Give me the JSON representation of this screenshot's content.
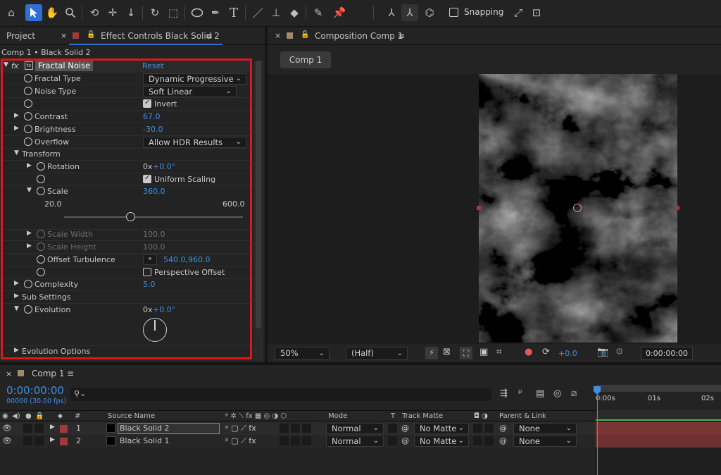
{
  "toolbar": {
    "snapping_label": "Snapping",
    "icons": [
      "home-icon",
      "selection-tool-icon",
      "hand-tool-icon",
      "zoom-tool-icon",
      "orbit-camera-icon",
      "pan-camera-icon",
      "dolly-camera-icon",
      "rotate-tool-icon",
      "pan-behind-icon",
      "ellipse-tool-icon",
      "pen-tool-icon",
      "type-tool-icon",
      "brush-tool-icon",
      "clone-stamp-icon",
      "eraser-icon",
      "roto-brush-icon",
      "puppet-pin-icon"
    ]
  },
  "effect_panel": {
    "tab_project": "Project",
    "tab_effect": "Effect Controls Black Solid 2",
    "breadcrumb": "Comp 1 • Black Solid 2",
    "effect_name": "Fractal Noise",
    "reset": "Reset",
    "fractal_type_label": "Fractal Type",
    "fractal_type_value": "Dynamic Progressive",
    "noise_type_label": "Noise Type",
    "noise_type_value": "Soft Linear",
    "invert_label": "Invert",
    "contrast_label": "Contrast",
    "contrast_value": "67.0",
    "brightness_label": "Brightness",
    "brightness_value": "-30.0",
    "overflow_label": "Overflow",
    "overflow_value": "Allow HDR Results",
    "transform_label": "Transform",
    "rotation_label": "Rotation",
    "rotation_value_a": "0x",
    "rotation_value_b": "+0.0°",
    "uniform_scaling_label": "Uniform Scaling",
    "scale_label": "Scale",
    "scale_value": "360.0",
    "scale_min": "20.0",
    "scale_max": "600.0",
    "scale_fraction": 0.371,
    "scale_width_label": "Scale Width",
    "scale_width_value": "100.0",
    "scale_height_label": "Scale Height",
    "scale_height_value": "100.0",
    "offset_label": "Offset Turbulence",
    "offset_value": "540.0,960.0",
    "perspective_label": "Perspective Offset",
    "complexity_label": "Complexity",
    "complexity_value": "5.0",
    "sub_settings_label": "Sub Settings",
    "evolution_label": "Evolution",
    "evolution_value_a": "0x",
    "evolution_value_b": "+0.0°",
    "evolution_options_label": "Evolution Options"
  },
  "composition": {
    "tab_title": "Composition Comp 1",
    "comp_button": "Comp 1",
    "zoom": "50%",
    "resolution": "(Half)",
    "exposure": "+0.0",
    "timecode": "0:00:00:00"
  },
  "timeline": {
    "tab_title": "Comp 1",
    "current_time": "0:00:00:00",
    "frame_info": "00000 (30.00 fps)",
    "ruler_labels": [
      "0:00s",
      "01s",
      "02s"
    ],
    "headers": {
      "number": "#",
      "source_name": "Source Name",
      "mode": "Mode",
      "t": "T",
      "track_matte": "Track Matte",
      "parent_link": "Parent & Link"
    },
    "layers": [
      {
        "num": "1",
        "name": "Black Solid 2",
        "mode": "Normal",
        "matte": "No Matte",
        "parent": "None"
      },
      {
        "num": "2",
        "name": "Black Solid 1",
        "mode": "Normal",
        "matte": "No Matte",
        "parent": "None"
      }
    ]
  },
  "colors": {
    "accent_blue": "#3d8fe6",
    "highlight_red": "#e0161e",
    "layer_label_red": "#a33a3a",
    "track_bar": "#7a3434"
  }
}
